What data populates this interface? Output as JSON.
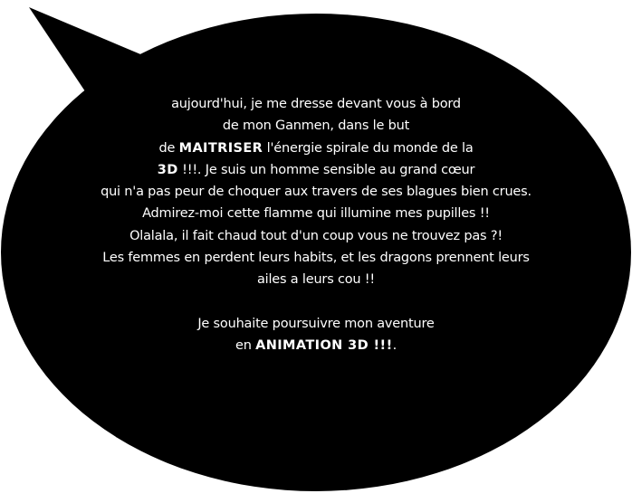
{
  "bubble": {
    "fill_color": "#000000",
    "text_color": "#ffffff",
    "background": "#ffffff"
  },
  "text": {
    "line1": "aujourd'hui, je me dresse devant vous à bord",
    "line2": "de mon Ganmen, dans le but",
    "line3_pre": "de ",
    "line3_bold": "MAITRISER",
    "line3_post": " l'énergie spirale du monde de la",
    "line4_bold": "3D",
    "line4_post": " !!!. Je suis un homme sensible au grand cœur",
    "line5": "qui n'a pas peur de choquer aux travers de ses blagues bien crues.",
    "line6": "Admirez-moi cette flamme qui illumine mes pupilles !!",
    "line7": "Olalala, il fait chaud tout d'un coup vous ne trouvez pas ?!",
    "line8": "Les femmes en perdent leurs habits, et les dragons prennent leurs",
    "line9": "ailes a leurs cou !!",
    "line10": "Je souhaite poursuivre mon aventure",
    "line11_pre": "en ",
    "line11_bold": "ANIMATION 3D !!!",
    "line11_post": "."
  }
}
